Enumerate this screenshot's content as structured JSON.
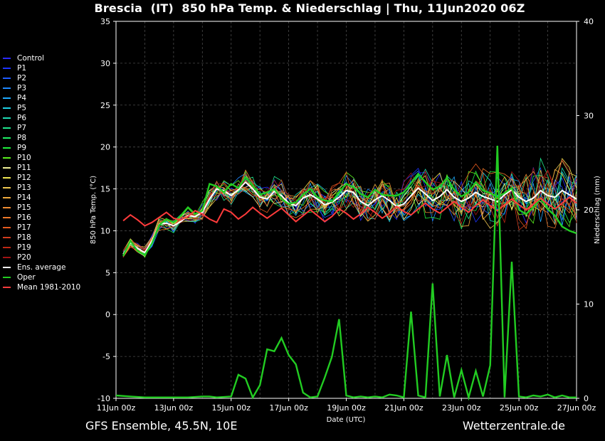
{
  "title": "Brescia  (IT)  850 hPa Temp. & Niederschlag | Thu, 11Jun2020 06Z",
  "footer": {
    "left": "GFS Ensemble, 45.5N, 10E",
    "right": "Wetterzentrale.de"
  },
  "colors": {
    "background": "#000000",
    "grid": "#4a4a4a",
    "axis": "#ffffff",
    "oper": "#22cc22",
    "mean": "#ff3b3b",
    "ens_average": "#ffffff"
  },
  "legend": [
    {
      "label": "Control",
      "color": "#2a2aff"
    },
    {
      "label": "P1",
      "color": "#1c34ff"
    },
    {
      "label": "P2",
      "color": "#1f5cff"
    },
    {
      "label": "P3",
      "color": "#1e88ff"
    },
    {
      "label": "P4",
      "color": "#1eaaff"
    },
    {
      "label": "P5",
      "color": "#1ed2e6"
    },
    {
      "label": "P6",
      "color": "#1edcb4"
    },
    {
      "label": "P7",
      "color": "#1ee68c"
    },
    {
      "label": "P8",
      "color": "#1ef064"
    },
    {
      "label": "P9",
      "color": "#1ef03c"
    },
    {
      "label": "P10",
      "color": "#5af01e"
    },
    {
      "label": "P11",
      "color": "#f0f096"
    },
    {
      "label": "P12",
      "color": "#f0e650"
    },
    {
      "label": "P13",
      "color": "#f0c850"
    },
    {
      "label": "P14",
      "color": "#f0aa3c"
    },
    {
      "label": "P15",
      "color": "#f08c32"
    },
    {
      "label": "P16",
      "color": "#f07828"
    },
    {
      "label": "P17",
      "color": "#e65a1e"
    },
    {
      "label": "P18",
      "color": "#d23c1e"
    },
    {
      "label": "P19",
      "color": "#be2814"
    },
    {
      "label": "P20",
      "color": "#a01414"
    },
    {
      "label": "Ens. average",
      "color": "#ffffff"
    },
    {
      "label": "Oper",
      "color": "#22cc22"
    },
    {
      "label": "Mean 1981-2010",
      "color": "#ff3b3b"
    }
  ],
  "chart_data": {
    "type": "line",
    "title": "Brescia  (IT)  850 hPa Temp. & Niederschlag | Thu, 11Jun2020 06Z",
    "xlabel": "Date (UTC)",
    "ylabel": "850 hPa Temp. (°C)",
    "ylabel_right": "Niederschlag (mm)",
    "ylim": [
      -10,
      35
    ],
    "ylim_right": [
      0,
      40
    ],
    "yticks": [
      -10,
      -5,
      0,
      5,
      10,
      15,
      20,
      25,
      30,
      35
    ],
    "yticks_right": [
      0,
      10,
      20,
      30,
      40
    ],
    "xlim_days": [
      0,
      16
    ],
    "xtick_labels": [
      "11Jun 00z",
      "13Jun 00z",
      "15Jun 00z",
      "17Jun 00z",
      "19Jun 00z",
      "21Jun 00z",
      "23Jun 00z",
      "25Jun 00z",
      "27Jun 00z"
    ],
    "grid": true,
    "legend_position": "left-outside",
    "temperature_x_days": [
      0.25,
      0.5,
      0.75,
      1.0,
      1.25,
      1.5,
      1.75,
      2.0,
      2.25,
      2.5,
      2.75,
      3.0,
      3.25,
      3.5,
      3.75,
      4.0,
      4.25,
      4.5,
      4.75,
      5.0,
      5.25,
      5.5,
      5.75,
      6.0,
      6.25,
      6.5,
      6.75,
      7.0,
      7.25,
      7.5,
      7.75,
      8.0,
      8.25,
      8.5,
      8.75,
      9.0,
      9.25,
      9.5,
      9.75,
      10.0,
      10.25,
      10.5,
      10.75,
      11.0,
      11.25,
      11.5,
      11.75,
      12.0,
      12.25,
      12.5,
      12.75,
      13.0,
      13.25,
      13.5,
      13.75,
      14.0,
      14.25,
      14.5,
      14.75,
      15.0,
      15.25,
      15.5,
      15.75,
      16.0
    ],
    "series": [
      {
        "name": "Ens. average",
        "color": "#ffffff",
        "values": [
          7.2,
          8.6,
          7.9,
          7.4,
          8.8,
          10.8,
          10.9,
          10.6,
          11.1,
          11.8,
          11.7,
          12.2,
          13.8,
          15.0,
          14.8,
          14.2,
          14.9,
          15.8,
          15.0,
          14.0,
          13.8,
          14.7,
          14.2,
          13.3,
          13.0,
          13.9,
          14.3,
          13.8,
          13.1,
          13.4,
          14.0,
          14.8,
          14.6,
          13.5,
          13.0,
          13.7,
          14.2,
          13.6,
          12.9,
          13.2,
          14.2,
          15.1,
          14.4,
          13.6,
          14.1,
          14.9,
          14.0,
          13.5,
          13.9,
          14.6,
          14.1,
          13.8,
          13.5,
          14.3,
          14.9,
          14.0,
          13.5,
          13.9,
          14.8,
          14.2,
          14.0,
          14.8,
          14.3,
          13.8
        ]
      },
      {
        "name": "Oper",
        "color": "#22cc22",
        "width": 2.4,
        "values": [
          7.0,
          8.8,
          7.6,
          7.1,
          8.5,
          10.7,
          11.4,
          11.0,
          11.8,
          12.8,
          12.0,
          12.4,
          15.6,
          15.3,
          14.6,
          15.6,
          15.1,
          16.4,
          15.4,
          14.3,
          14.6,
          15.0,
          13.8,
          13.2,
          13.4,
          14.3,
          15.0,
          14.0,
          13.6,
          13.5,
          14.6,
          15.6,
          15.2,
          14.4,
          14.0,
          14.9,
          14.3,
          14.2,
          14.2,
          14.6,
          15.7,
          16.8,
          15.8,
          14.9,
          15.3,
          16.3,
          14.9,
          14.1,
          14.6,
          15.8,
          14.8,
          14.5,
          14.0,
          14.5,
          15.1,
          12.5,
          12.0,
          12.8,
          13.9,
          12.6,
          11.8,
          10.5,
          10.0,
          9.7
        ]
      },
      {
        "name": "Mean 1981-2010",
        "color": "#ff3b3b",
        "width": 2.0,
        "values": [
          11.2,
          11.9,
          11.3,
          10.6,
          11.0,
          11.6,
          12.2,
          11.5,
          11.3,
          11.7,
          12.4,
          12.0,
          11.4,
          11.0,
          12.6,
          12.2,
          11.4,
          12.0,
          12.8,
          12.1,
          11.5,
          12.1,
          12.7,
          11.9,
          11.1,
          11.8,
          12.5,
          11.8,
          11.1,
          11.7,
          12.6,
          12.1,
          11.4,
          12.0,
          12.8,
          12.2,
          11.5,
          12.1,
          12.9,
          12.3,
          11.9,
          12.6,
          13.3,
          12.6,
          12.1,
          12.8,
          13.5,
          12.8,
          12.2,
          13.0,
          13.7,
          13.0,
          12.4,
          13.1,
          13.8,
          13.1,
          12.5,
          13.2,
          13.9,
          13.2,
          12.6,
          13.3,
          14.0,
          13.3
        ]
      }
    ],
    "precipitation_oper": {
      "name": "Oper",
      "x_days": [
        0,
        0.5,
        1.0,
        1.5,
        2.0,
        2.5,
        3.0,
        3.25,
        3.5,
        4.0,
        4.25,
        4.5,
        4.75,
        5.0,
        5.25,
        5.5,
        5.75,
        6.0,
        6.25,
        6.5,
        6.75,
        7.0,
        7.25,
        7.5,
        7.75,
        8.0,
        8.25,
        8.5,
        8.75,
        9.0,
        9.25,
        9.5,
        9.75,
        10.0,
        10.25,
        10.5,
        10.75,
        11.0,
        11.25,
        11.5,
        11.75,
        12.0,
        12.25,
        12.5,
        12.75,
        13.0,
        13.25,
        13.5,
        13.75,
        14.0,
        14.25,
        14.5,
        14.75,
        15.0,
        15.25,
        15.5,
        15.75,
        16.0
      ],
      "values_mm": [
        0.3,
        0.2,
        0.1,
        0.1,
        0.1,
        0.1,
        0.2,
        0.2,
        0.1,
        0.2,
        2.5,
        2.1,
        0.1,
        1.4,
        5.2,
        5.0,
        6.4,
        4.6,
        3.6,
        0.6,
        0.1,
        0.2,
        2.2,
        4.4,
        8.4,
        0.3,
        0.1,
        0.2,
        0.1,
        0.2,
        0.1,
        0.4,
        0.3,
        0.1,
        9.2,
        0.3,
        0.1,
        12.2,
        0.2,
        4.6,
        0.1,
        3.0,
        0.1,
        2.9,
        0.2,
        3.5,
        26.8,
        0.1,
        14.5,
        0.2,
        0.1,
        0.3,
        0.2,
        0.4,
        0.1,
        0.3,
        0.1,
        0.1
      ]
    }
  }
}
